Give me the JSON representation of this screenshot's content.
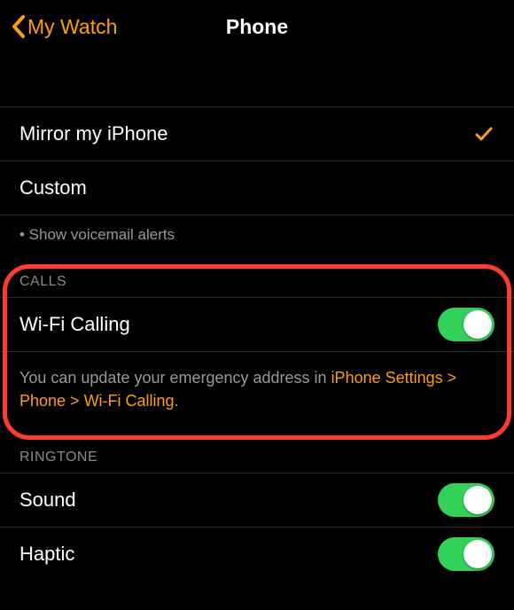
{
  "header": {
    "back_label": "My Watch",
    "title": "Phone"
  },
  "mode": {
    "mirror_label": "Mirror my iPhone",
    "mirror_selected": "true",
    "custom_label": "Custom",
    "voicemail_note": "• Show voicemail alerts"
  },
  "calls": {
    "section": "CALLS",
    "wifi_label": "Wi-Fi Calling",
    "wifi_on": "true",
    "footer_pre": "You can update your emergency address in ",
    "footer_link": "iPhone Settings > Phone > Wi-Fi Calling",
    "footer_post": "."
  },
  "ringtone": {
    "section": "RINGTONE",
    "sound_label": "Sound",
    "sound_on": "true",
    "haptic_label": "Haptic",
    "haptic_on": "true"
  }
}
